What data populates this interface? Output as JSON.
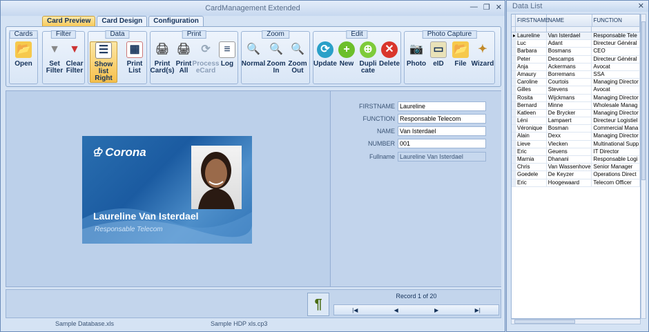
{
  "window": {
    "title": "CardManagement Extended"
  },
  "tabs": [
    {
      "label": "Card Preview",
      "active": true
    },
    {
      "label": "Card Design"
    },
    {
      "label": "Configuration"
    }
  ],
  "ribbon": {
    "groups": {
      "cards": "Cards",
      "filter": "Filter",
      "data": "Data",
      "print": "Print",
      "zoom": "Zoom",
      "edit": "Edit",
      "photo": "Photo Capture"
    },
    "buttons": {
      "open": "Open",
      "set_filter": "Set Filter",
      "clear_filter": "Clear Filter",
      "show_list_right": "Show list Right",
      "print_list": "Print List",
      "print_cards": "Print Card(s)",
      "print_all": "Print All",
      "process_ecard": "Process eCard",
      "log": "Log",
      "zoom_normal": "Normal",
      "zoom_in": "Zoom In",
      "zoom_out": "Zoom Out",
      "update": "Update",
      "new": "New",
      "duplicate": "Dupli cate",
      "delete": "Delete",
      "photo": "Photo",
      "eid": "eID",
      "file": "File",
      "wizard": "Wizard"
    }
  },
  "card": {
    "logo": "Corona",
    "name": "Laureline Van Isterdael",
    "function": "Responsable Telecom"
  },
  "form": {
    "firstname_label": "FIRSTNAME",
    "firstname": "Laureline",
    "function_label": "FUNCTION",
    "function": "Responsable Telecom",
    "name_label": "NAME",
    "name": "Van Isterdael",
    "number_label": "NUMBER",
    "number": "001",
    "fullname_label": "Fullname",
    "fullname": "Laureline Van Isterdael"
  },
  "navigation": {
    "record": "Record 1 of 20",
    "first": "▶|",
    "prev": "◀",
    "next": "▶",
    "last": "▶|"
  },
  "status": {
    "database": "Sample Database.xls",
    "layout": "Sample HDP xls.cp3"
  },
  "data_list": {
    "title": "Data List",
    "columns": [
      "FIRSTNAME",
      "NAME",
      "FUNCTION"
    ],
    "rows": [
      [
        "Laureline",
        "Van Isterdael",
        "Responsable Tele"
      ],
      [
        "Luc",
        "Adant",
        "Directeur Général"
      ],
      [
        "Barbara",
        "Bosmans",
        "CEO"
      ],
      [
        "Peter",
        "Descamps",
        "Directeur Général"
      ],
      [
        "Anja",
        "Ackermans",
        "Avocat"
      ],
      [
        "Amaury",
        "Borremans",
        "SSA"
      ],
      [
        "Caroline",
        "Courtois",
        "Managing Director"
      ],
      [
        "Gilles",
        "Stevens",
        "Avocat"
      ],
      [
        "Rosita",
        "Wijckmans",
        "Managing Director"
      ],
      [
        "Bernard",
        "Minne",
        "Wholesale Manag"
      ],
      [
        "Katleen",
        "De Brycker",
        "Managing Director"
      ],
      [
        "Léni",
        "Lampaert",
        "Directeur Logistiel"
      ],
      [
        "Véronique",
        "Bosman",
        "Commercial Mana"
      ],
      [
        "Alain",
        "Dexx",
        "Managing Director"
      ],
      [
        "Lieve",
        "Vlecken",
        "Multinational Supp"
      ],
      [
        "Eric",
        "Geuens",
        "IT Director"
      ],
      [
        "Marnia",
        "Dhanani",
        "Responsable Logi"
      ],
      [
        "Chris",
        "Van Wassenhoven",
        "Senior Manager"
      ],
      [
        "Goedele",
        "De Keyzer",
        "Operations Direct"
      ],
      [
        "Eric",
        "Hoogewaard",
        "Telecom Officer"
      ]
    ]
  }
}
